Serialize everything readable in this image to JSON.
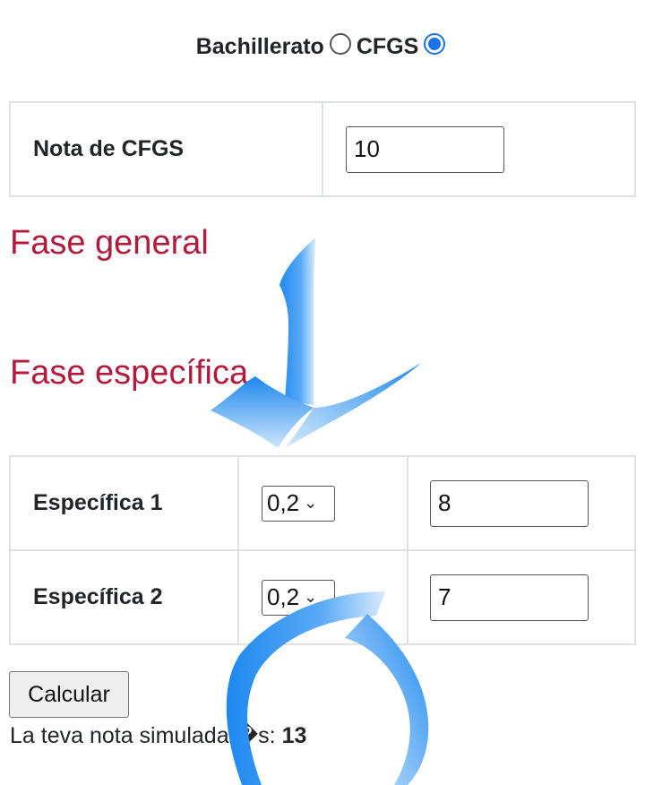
{
  "mode": {
    "option1_label": "Bachillerato",
    "option2_label": "CFGS",
    "selected": "CFGS"
  },
  "cfgs": {
    "label": "Nota de CFGS",
    "value": "10"
  },
  "headings": {
    "general": "Fase general",
    "specific": "Fase específica"
  },
  "specific_rows": [
    {
      "label": "Específica 1",
      "weight": "0,2",
      "grade": "8"
    },
    {
      "label": "Específica 2",
      "weight": "0,2",
      "grade": "7"
    }
  ],
  "calculate_label": "Calcular",
  "result": {
    "prefix": "La teva nota simulada �s:",
    "value": "13"
  },
  "colors": {
    "heading": "#b31b3c",
    "radio_accent": "#1a73e8",
    "annotation": "#1e88f0"
  }
}
